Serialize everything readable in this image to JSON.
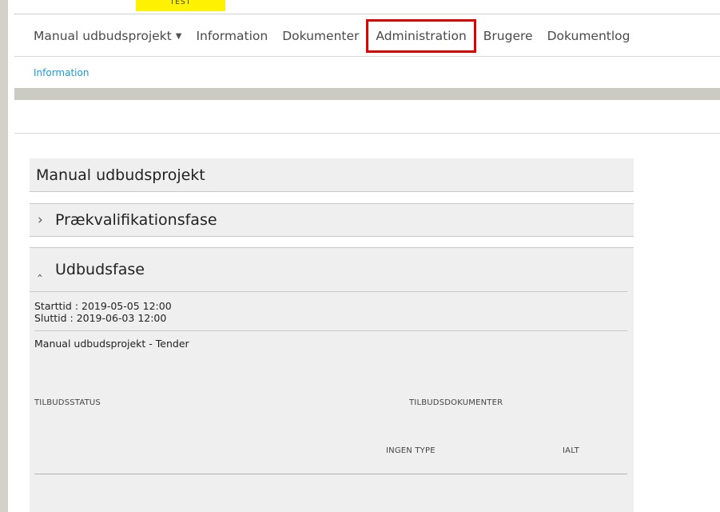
{
  "env_badge": "TEST",
  "nav": {
    "project_label": "Manual udbudsprojekt",
    "items": [
      "Information",
      "Dokumenter",
      "Administration",
      "Brugere",
      "Dokumentlog"
    ]
  },
  "subnav": {
    "active": "Information"
  },
  "project_panel": {
    "title": "Manual udbudsprojekt"
  },
  "phase_prequal": {
    "title": "Prækvalifikationsfase"
  },
  "phase_tender": {
    "title": "Udbudsfase",
    "start": "Starttid : 2019-05-05 12:00",
    "end": "Sluttid : 2019-06-03 12:00",
    "tender_name": "Manual udbudsprojekt - Tender",
    "columns": {
      "status": "TILBUDSSTATUS",
      "documents": "TILBUDSDOKUMENTER",
      "no_type": "INGEN TYPE",
      "total": "IALT"
    }
  }
}
